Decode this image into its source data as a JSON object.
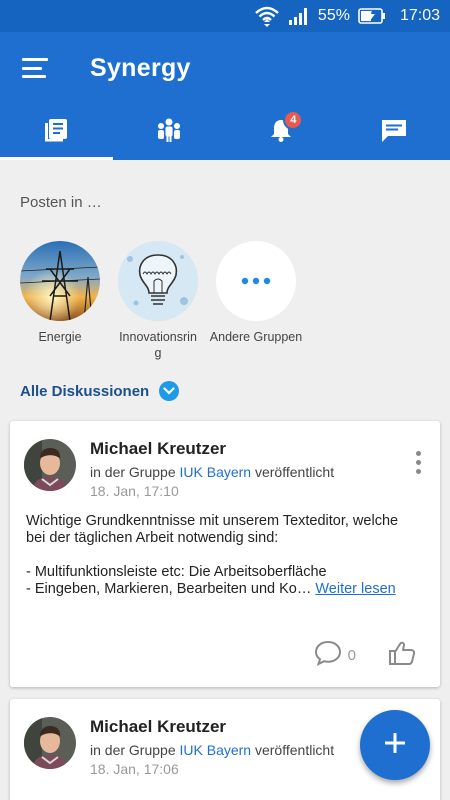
{
  "status": {
    "battery": "55%",
    "time": "17:03"
  },
  "app": {
    "title": "Synergy"
  },
  "tabs": [
    {
      "name": "feed",
      "icon": "feed-icon",
      "active": true
    },
    {
      "name": "people",
      "icon": "people-icon"
    },
    {
      "name": "notifications",
      "icon": "bell-icon",
      "badge": "4"
    },
    {
      "name": "messages",
      "icon": "chat-icon"
    }
  ],
  "post_in": {
    "label": "Posten in …",
    "groups": [
      {
        "label": "Energie",
        "icon": "power-lines-image"
      },
      {
        "label": "Innovationsring",
        "icon": "lightbulb-image"
      },
      {
        "label": "Andere Gruppen",
        "icon": "more-dots-icon"
      }
    ]
  },
  "filter": {
    "label": "Alle Diskussionen"
  },
  "posts": [
    {
      "author": "Michael Kreutzer",
      "meta_prefix": "in der Gruppe",
      "group": "IUK Bayern",
      "meta_suffix": "veröffentlicht",
      "date": "18. Jan, 17:10",
      "line1": "Wichtige Grundkenntnisse mit unserem Texteditor, welche",
      "line2": "bei der täglichen Arbeit notwendig sind:",
      "line3": "- Multifunktionsleiste etc: Die Arbeitsoberfläche",
      "line4": "- Eingeben, Markieren, Bearbeiten und Ko…",
      "read_more": "Weiter lesen",
      "comments": "0"
    },
    {
      "author": "Michael Kreutzer",
      "meta_prefix": "in der Gruppe",
      "group": "IUK Bayern",
      "meta_suffix": "veröffentlicht",
      "date": "18. Jan, 17:06"
    }
  ],
  "colors": {
    "primary": "#1e6fd0",
    "status_bar": "#1565c0",
    "badge": "#e85a4f",
    "link": "#1e6fd0"
  }
}
